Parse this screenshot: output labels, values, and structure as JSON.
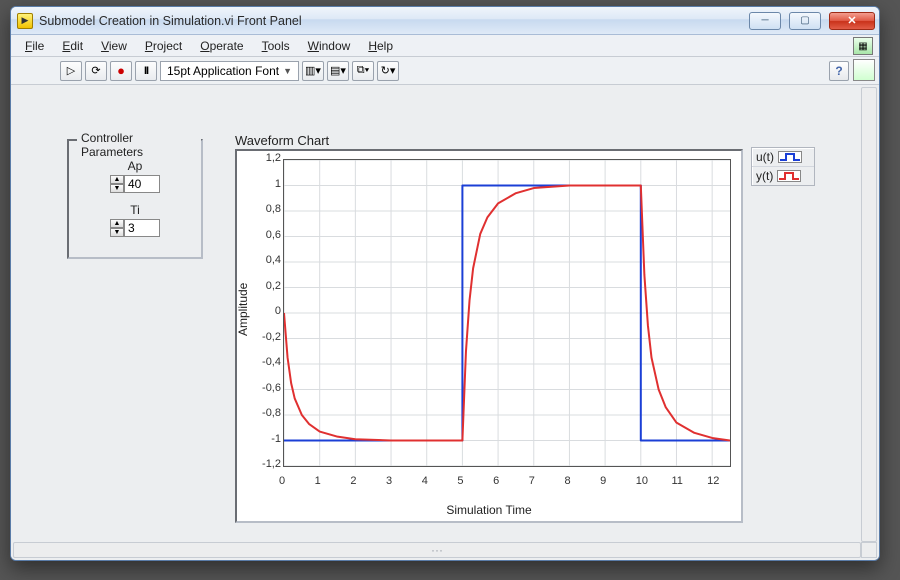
{
  "window": {
    "title": "Submodel Creation in Simulation.vi Front Panel"
  },
  "menubar": {
    "items": [
      "File",
      "Edit",
      "View",
      "Project",
      "Operate",
      "Tools",
      "Window",
      "Help"
    ]
  },
  "toolbar": {
    "font_label": "15pt Application Font"
  },
  "controller": {
    "group_label": "Controller Parameters",
    "ap_label": "Ap",
    "ap_value": "40",
    "ti_label": "Ti",
    "ti_value": "3"
  },
  "chart": {
    "title": "Waveform Chart",
    "xlabel": "Simulation Time",
    "ylabel": "Amplitude"
  },
  "legend": {
    "u": "u(t)",
    "y": "y(t)"
  },
  "chart_data": {
    "type": "line",
    "title": "Waveform Chart",
    "xlabel": "Simulation Time",
    "ylabel": "Amplitude",
    "xlim": [
      0,
      12.5
    ],
    "ylim": [
      -1.2,
      1.2
    ],
    "xticks": [
      0,
      1,
      2,
      3,
      4,
      5,
      6,
      7,
      8,
      9,
      10,
      11,
      12
    ],
    "yticks": [
      -1.2,
      -1,
      -0.8,
      -0.6,
      -0.4,
      -0.2,
      0,
      0.2,
      0.4,
      0.6,
      0.8,
      1,
      1.2
    ],
    "series": [
      {
        "name": "u(t)",
        "color": "#1b3fd6",
        "x": [
          0,
          5,
          5,
          10,
          10,
          12.5
        ],
        "values": [
          -1,
          -1,
          1,
          1,
          -1,
          -1
        ]
      },
      {
        "name": "y(t)",
        "color": "#e03030",
        "x": [
          0,
          0.1,
          0.2,
          0.3,
          0.5,
          0.7,
          1.0,
          1.5,
          2.0,
          3.0,
          4.0,
          5.0,
          5.1,
          5.2,
          5.3,
          5.5,
          5.7,
          6.0,
          6.5,
          7.0,
          8.0,
          9.0,
          10.0,
          10.1,
          10.2,
          10.3,
          10.5,
          10.7,
          11.0,
          11.5,
          12.0,
          12.5
        ],
        "values": [
          0,
          -0.35,
          -0.55,
          -0.67,
          -0.8,
          -0.87,
          -0.93,
          -0.97,
          -0.99,
          -1.0,
          -1.0,
          -1.0,
          -0.3,
          0.1,
          0.35,
          0.62,
          0.75,
          0.86,
          0.94,
          0.98,
          1.0,
          1.0,
          1.0,
          0.3,
          -0.1,
          -0.35,
          -0.6,
          -0.74,
          -0.86,
          -0.94,
          -0.98,
          -1.0
        ]
      }
    ]
  }
}
